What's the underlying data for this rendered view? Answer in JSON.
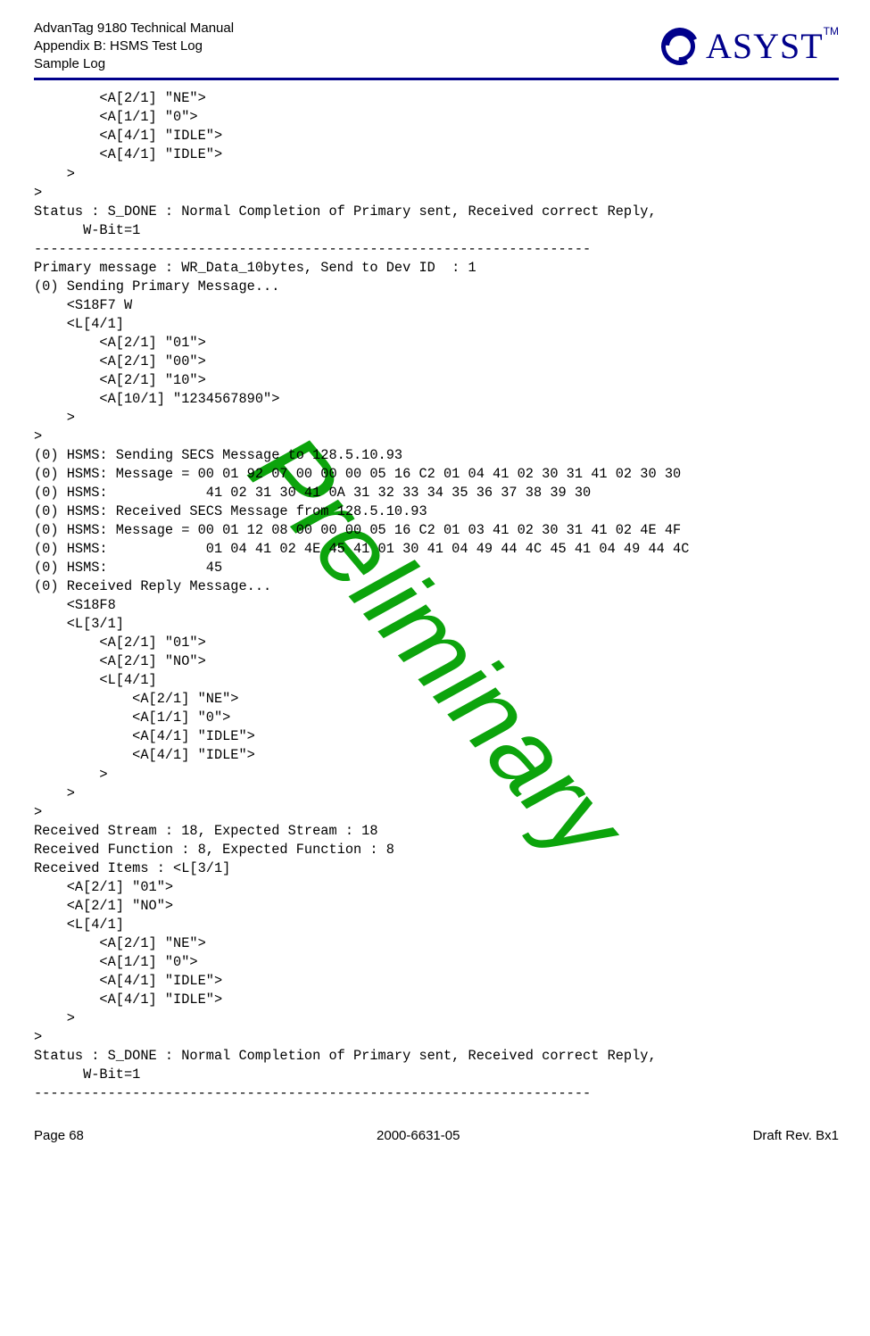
{
  "header": {
    "line1": "AdvanTag 9180 Technical Manual",
    "line2": "Appendix B: HSMS Test Log",
    "line3": "Sample Log",
    "logo_text": "ASYST",
    "logo_tm": "TM"
  },
  "watermark": "Preliminary",
  "log": "        <A[2/1] \"NE\">\n        <A[1/1] \"0\">\n        <A[4/1] \"IDLE\">\n        <A[4/1] \"IDLE\">\n    >\n>\nStatus : S_DONE : Normal Completion of Primary sent, Received correct Reply, \n      W-Bit=1\n--------------------------------------------------------------------\nPrimary message : WR_Data_10bytes, Send to Dev ID  : 1\n(0) Sending Primary Message...\n    <S18F7 W\n    <L[4/1]\n        <A[2/1] \"01\">\n        <A[2/1] \"00\">\n        <A[2/1] \"10\">\n        <A[10/1] \"1234567890\">\n    >\n>\n(0) HSMS: Sending SECS Message to 128.5.10.93\n(0) HSMS: Message = 00 01 92 07 00 00 00 05 16 C2 01 04 41 02 30 31 41 02 30 30 \n(0) HSMS:            41 02 31 30 41 0A 31 32 33 34 35 36 37 38 39 30 \n(0) HSMS: Received SECS Message from 128.5.10.93\n(0) HSMS: Message = 00 01 12 08 00 00 00 05 16 C2 01 03 41 02 30 31 41 02 4E 4F \n(0) HSMS:            01 04 41 02 4E 45 41 01 30 41 04 49 44 4C 45 41 04 49 44 4C \n(0) HSMS:            45 \n(0) Received Reply Message...\n    <S18F8\n    <L[3/1]\n        <A[2/1] \"01\">\n        <A[2/1] \"NO\">\n        <L[4/1]\n            <A[2/1] \"NE\">\n            <A[1/1] \"0\">\n            <A[4/1] \"IDLE\">\n            <A[4/1] \"IDLE\">\n        >\n    >\n>\nReceived Stream : 18, Expected Stream : 18\nReceived Function : 8, Expected Function : 8\nReceived Items : <L[3/1]\n    <A[2/1] \"01\">\n    <A[2/1] \"NO\">\n    <L[4/1]\n        <A[2/1] \"NE\">\n        <A[1/1] \"0\">\n        <A[4/1] \"IDLE\">\n        <A[4/1] \"IDLE\">\n    >\n>\nStatus : S_DONE : Normal Completion of Primary sent, Received correct Reply, \n      W-Bit=1\n--------------------------------------------------------------------",
  "footer": {
    "left": "Page 68",
    "center": "2000-6631-05",
    "right": "Draft Rev. Bx1"
  }
}
